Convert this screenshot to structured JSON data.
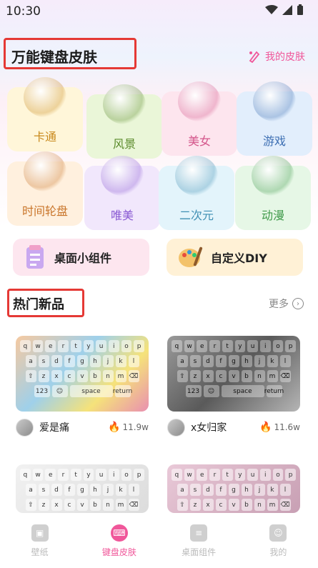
{
  "status": {
    "time": "10:30"
  },
  "header": {
    "title": "万能键盘皮肤",
    "my_skin": "我的皮肤"
  },
  "categories": [
    {
      "label": "卡通",
      "color": "#fff6d9",
      "text_color": "#c98a1d",
      "art": "cat-figure-icon"
    },
    {
      "label": "风景",
      "color": "#eaf6d8",
      "text_color": "#5a8a2a",
      "art": "flower-icon"
    },
    {
      "label": "美女",
      "color": "#fde5ee",
      "text_color": "#d4568b",
      "art": "girl-figure-icon"
    },
    {
      "label": "游戏",
      "color": "#e2eefc",
      "text_color": "#3d6fb3",
      "art": "gamepad-icon"
    },
    {
      "label": "时间轮盘",
      "color": "#fff0de",
      "text_color": "#c9752a",
      "art": "clock-icon"
    },
    {
      "label": "唯美",
      "color": "#f1e7fc",
      "text_color": "#8a5ad3",
      "art": "petal-icon"
    },
    {
      "label": "二次元",
      "color": "#e3f4fb",
      "text_color": "#3f8fb3",
      "art": "anime-figure-icon"
    },
    {
      "label": "动漫",
      "color": "#e6f7e6",
      "text_color": "#3f9a4a",
      "art": "doll-figure-icon"
    }
  ],
  "widgets": [
    {
      "label": "桌面小组件"
    },
    {
      "label": "自定义DIY"
    }
  ],
  "hot": {
    "title": "热门新品",
    "more": "更多"
  },
  "keyboard_keys": {
    "row1": [
      "q",
      "w",
      "e",
      "r",
      "t",
      "y",
      "u",
      "i",
      "o",
      "p"
    ],
    "row2": [
      "a",
      "s",
      "d",
      "f",
      "g",
      "h",
      "j",
      "k",
      "l"
    ],
    "row3": [
      "⇧",
      "z",
      "x",
      "c",
      "v",
      "b",
      "n",
      "m",
      "⌫"
    ],
    "row4": [
      "123",
      "☺",
      "space",
      "return"
    ]
  },
  "items": [
    {
      "name": "爱是痛",
      "count": "11.9w"
    },
    {
      "name": "x女归家",
      "count": "11.6w"
    }
  ],
  "nav": [
    {
      "label": "壁纸"
    },
    {
      "label": "键盘皮肤"
    },
    {
      "label": "桌面组件"
    },
    {
      "label": "我的"
    }
  ]
}
